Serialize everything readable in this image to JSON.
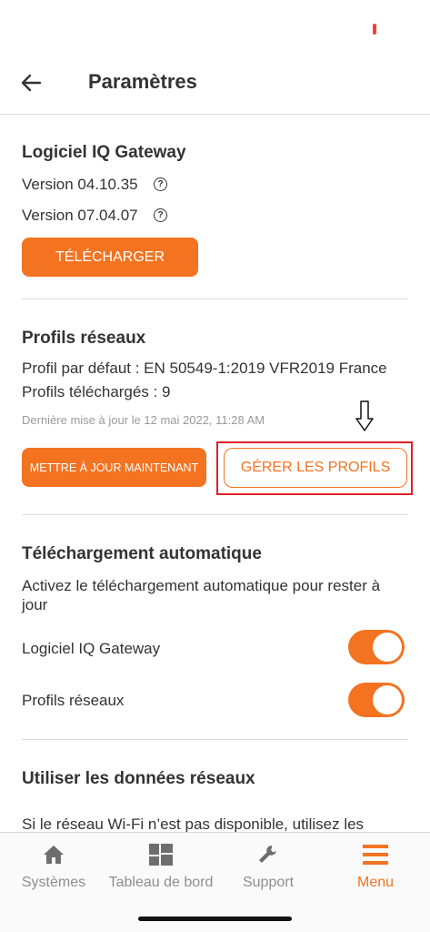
{
  "header": {
    "title": "Paramètres"
  },
  "gateway": {
    "title": "Logiciel IQ Gateway",
    "version_1": "Version 04.10.35",
    "version_2": "Version 07.04.07",
    "download_label": "TÉLÉCHARGER"
  },
  "profiles": {
    "title": "Profils réseaux",
    "default_profile": "Profil par défaut : EN 50549-1:2019 VFR2019 France",
    "downloaded": "Profils téléchargés : 9",
    "last_update": "Dernière mise à jour le 12 mai 2022, 11:28 AM",
    "update_now_label": "METTRE À JOUR MAINTENANT",
    "manage_label": "GÉRER LES PROFILS"
  },
  "auto_download": {
    "title": "Téléchargement automatique",
    "description": "Activez le téléchargement automatique pour rester à jour",
    "items": [
      {
        "label": "Logiciel IQ Gateway",
        "enabled": true
      },
      {
        "label": "Profils réseaux",
        "enabled": true
      }
    ]
  },
  "network_data": {
    "title": "Utiliser les données réseaux",
    "description": "Si le réseau Wi-Fi n’est pas disponible, utilisez les"
  },
  "tabbar": {
    "items": [
      {
        "label": "Systèmes",
        "icon": "home-icon",
        "active": false
      },
      {
        "label": "Tableau de bord",
        "icon": "dashboard-icon",
        "active": false
      },
      {
        "label": "Support",
        "icon": "wrench-icon",
        "active": false
      },
      {
        "label": "Menu",
        "icon": "menu-icon",
        "active": true
      }
    ]
  },
  "colors": {
    "accent": "#f37321",
    "highlight": "#e0202a",
    "text": "#333333",
    "muted": "#9a9a9a"
  }
}
